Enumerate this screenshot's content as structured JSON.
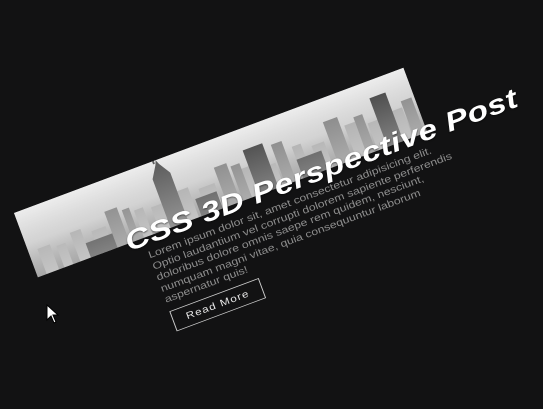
{
  "post": {
    "title": "CSS 3D Perspective Post",
    "body": "Lorem ipsum dolor sit, amet consectetur adipisicing elit. Optio laudantium vel corrupti dolorem sapiente perferendis doloribus dolore omnis saepe rem quidem, nesciunt, numquam magni vitae, quia consequuntur laborum aspernatur quis!",
    "read_more_label": "Read More"
  },
  "colors": {
    "background": "#121213",
    "title": "#ffffff",
    "body_text": "#8e8e8e",
    "button_border": "#cfcfcf"
  },
  "icons": {
    "pointer": "mouse-pointer-icon"
  }
}
